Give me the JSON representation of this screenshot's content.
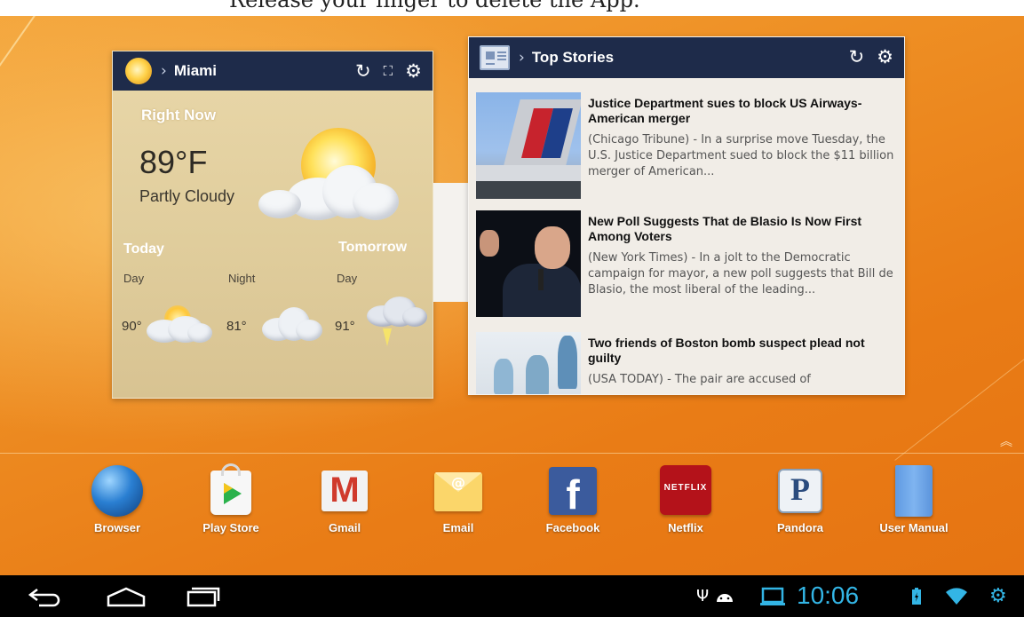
{
  "instruction_banner": "Release your finger to delete the App.",
  "weather_widget": {
    "city": "Miami",
    "right_now_label": "Right Now",
    "current_temp": "89°F",
    "condition": "Partly Cloudy",
    "today_label": "Today",
    "tomorrow_label": "Tomorrow",
    "forecast": [
      {
        "period": "Day",
        "temp": "90°",
        "icon": "partly-cloudy-icon"
      },
      {
        "period": "Night",
        "temp": "81°",
        "icon": "cloudy-icon"
      },
      {
        "period": "Day",
        "temp": "91°",
        "icon": "thunderstorm-icon"
      }
    ],
    "icons": {
      "refresh": "refresh-icon",
      "expand": "expand-icon",
      "settings": "gear-icon"
    }
  },
  "news_widget": {
    "title": "Top Stories",
    "stories": [
      {
        "headline": "Justice Department sues to block US Airways-American merger",
        "summary": "(Chicago Tribune) - In a surprise move Tuesday, the U.S. Justice Department sued to block the $11 billion merger of American...",
        "image": "airplane-tail-photo"
      },
      {
        "headline": "New Poll Suggests That de Blasio Is Now First Among Voters",
        "summary": "(New York Times) - In a jolt to the Democratic campaign for mayor, a new poll suggests that Bill de Blasio, the most liberal of the leading...",
        "image": "speaker-photo"
      },
      {
        "headline": "Two friends of Boston bomb suspect plead not guilty",
        "summary": "(USA TODAY) - The pair are accused of",
        "image": "courtroom-sketch-photo"
      }
    ]
  },
  "dock": {
    "apps": [
      {
        "label": "Browser",
        "icon": "globe-icon"
      },
      {
        "label": "Play Store",
        "icon": "play-store-icon"
      },
      {
        "label": "Gmail",
        "icon": "gmail-icon"
      },
      {
        "label": "Email",
        "icon": "email-icon"
      },
      {
        "label": "Facebook",
        "icon": "facebook-icon"
      },
      {
        "label": "Netflix",
        "icon": "netflix-icon",
        "icon_text": "NETFLIX"
      },
      {
        "label": "Pandora",
        "icon": "pandora-icon",
        "icon_text": "P"
      },
      {
        "label": "User Manual",
        "icon": "book-icon"
      }
    ]
  },
  "navbar": {
    "clock": "10:06",
    "buttons": [
      "back-icon",
      "home-icon",
      "recent-apps-icon"
    ],
    "status_icons": [
      "usb-icon",
      "android-debug-icon",
      "screen-icon",
      "battery-icon",
      "wifi-icon",
      "settings-icon"
    ],
    "accent": "#33b5e5"
  },
  "colors": {
    "widget_bar": "#1e2b4a",
    "wallpaper": "#e8821c"
  }
}
